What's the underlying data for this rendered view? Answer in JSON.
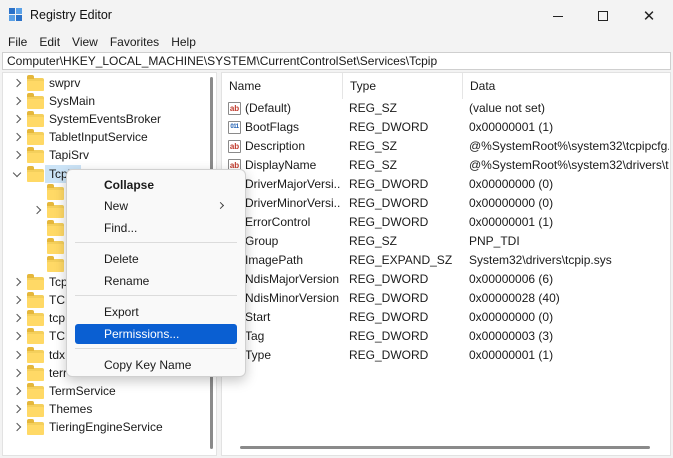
{
  "window": {
    "title": "Registry Editor",
    "app_icon": "registry-icon"
  },
  "menubar": [
    "File",
    "Edit",
    "View",
    "Favorites",
    "Help"
  ],
  "address": "Computer\\HKEY_LOCAL_MACHINE\\SYSTEM\\CurrentControlSet\\Services\\Tcpip",
  "tree": [
    {
      "label": "swprv",
      "chevron": "right"
    },
    {
      "label": "SysMain",
      "chevron": "right"
    },
    {
      "label": "SystemEventsBroker",
      "chevron": "right"
    },
    {
      "label": "TabletInputService",
      "chevron": "right"
    },
    {
      "label": "TapiSrv",
      "chevron": "right"
    },
    {
      "label": "Tcpip",
      "chevron": "down",
      "selected": true
    },
    {
      "label": "",
      "chevron": "none",
      "child": true
    },
    {
      "label": "",
      "chevron": "right",
      "child": true
    },
    {
      "label": "",
      "chevron": "none",
      "child": true
    },
    {
      "label": "",
      "chevron": "none",
      "child": true
    },
    {
      "label": "",
      "chevron": "none",
      "child": true
    },
    {
      "label": "Tcp",
      "chevron": "right"
    },
    {
      "label": "TCP",
      "chevron": "right"
    },
    {
      "label": "tcp",
      "chevron": "right"
    },
    {
      "label": "TCP",
      "chevron": "right"
    },
    {
      "label": "tdx",
      "chevron": "right"
    },
    {
      "label": "terr",
      "chevron": "right"
    },
    {
      "label": "TermService",
      "chevron": "right"
    },
    {
      "label": "Themes",
      "chevron": "right"
    },
    {
      "label": "TieringEngineService",
      "chevron": "right"
    }
  ],
  "columns": {
    "name": "Name",
    "type": "Type",
    "data": "Data"
  },
  "values": [
    {
      "icon": "string-value-icon",
      "name": "(Default)",
      "type": "REG_SZ",
      "data": "(value not set)"
    },
    {
      "icon": "binary-value-icon",
      "name": "BootFlags",
      "type": "REG_DWORD",
      "data": "0x00000001 (1)"
    },
    {
      "icon": "string-value-icon",
      "name": "Description",
      "type": "REG_SZ",
      "data": "@%SystemRoot%\\system32\\tcpipcfg."
    },
    {
      "icon": "string-value-icon",
      "name": "DisplayName",
      "type": "REG_SZ",
      "data": "@%SystemRoot%\\system32\\drivers\\tc"
    },
    {
      "icon": "binary-value-icon",
      "name": "DriverMajorVersi...",
      "type": "REG_DWORD",
      "data": "0x00000000 (0)"
    },
    {
      "icon": "binary-value-icon",
      "name": "DriverMinorVersi...",
      "type": "REG_DWORD",
      "data": "0x00000000 (0)"
    },
    {
      "icon": "binary-value-icon",
      "name": "ErrorControl",
      "type": "REG_DWORD",
      "data": "0x00000001 (1)"
    },
    {
      "icon": "string-value-icon",
      "name": "Group",
      "type": "REG_SZ",
      "data": "PNP_TDI"
    },
    {
      "icon": "string-value-icon",
      "name": "ImagePath",
      "type": "REG_EXPAND_SZ",
      "data": "System32\\drivers\\tcpip.sys"
    },
    {
      "icon": "binary-value-icon",
      "name": "NdisMajorVersion",
      "type": "REG_DWORD",
      "data": "0x00000006 (6)"
    },
    {
      "icon": "binary-value-icon",
      "name": "NdisMinorVersion",
      "type": "REG_DWORD",
      "data": "0x00000028 (40)"
    },
    {
      "icon": "binary-value-icon",
      "name": "Start",
      "type": "REG_DWORD",
      "data": "0x00000000 (0)"
    },
    {
      "icon": "binary-value-icon",
      "name": "Tag",
      "type": "REG_DWORD",
      "data": "0x00000003 (3)"
    },
    {
      "icon": "binary-value-icon",
      "name": "Type",
      "type": "REG_DWORD",
      "data": "0x00000001 (1)"
    }
  ],
  "context_menu": {
    "collapse": "Collapse",
    "new": "New",
    "find": "Find...",
    "delete": "Delete",
    "rename": "Rename",
    "export": "Export",
    "permissions": "Permissions...",
    "copy_key_name": "Copy Key Name"
  },
  "colors": {
    "highlight": "#0a5fd2",
    "selection": "#cce4f7",
    "folder": "#ffd966"
  }
}
